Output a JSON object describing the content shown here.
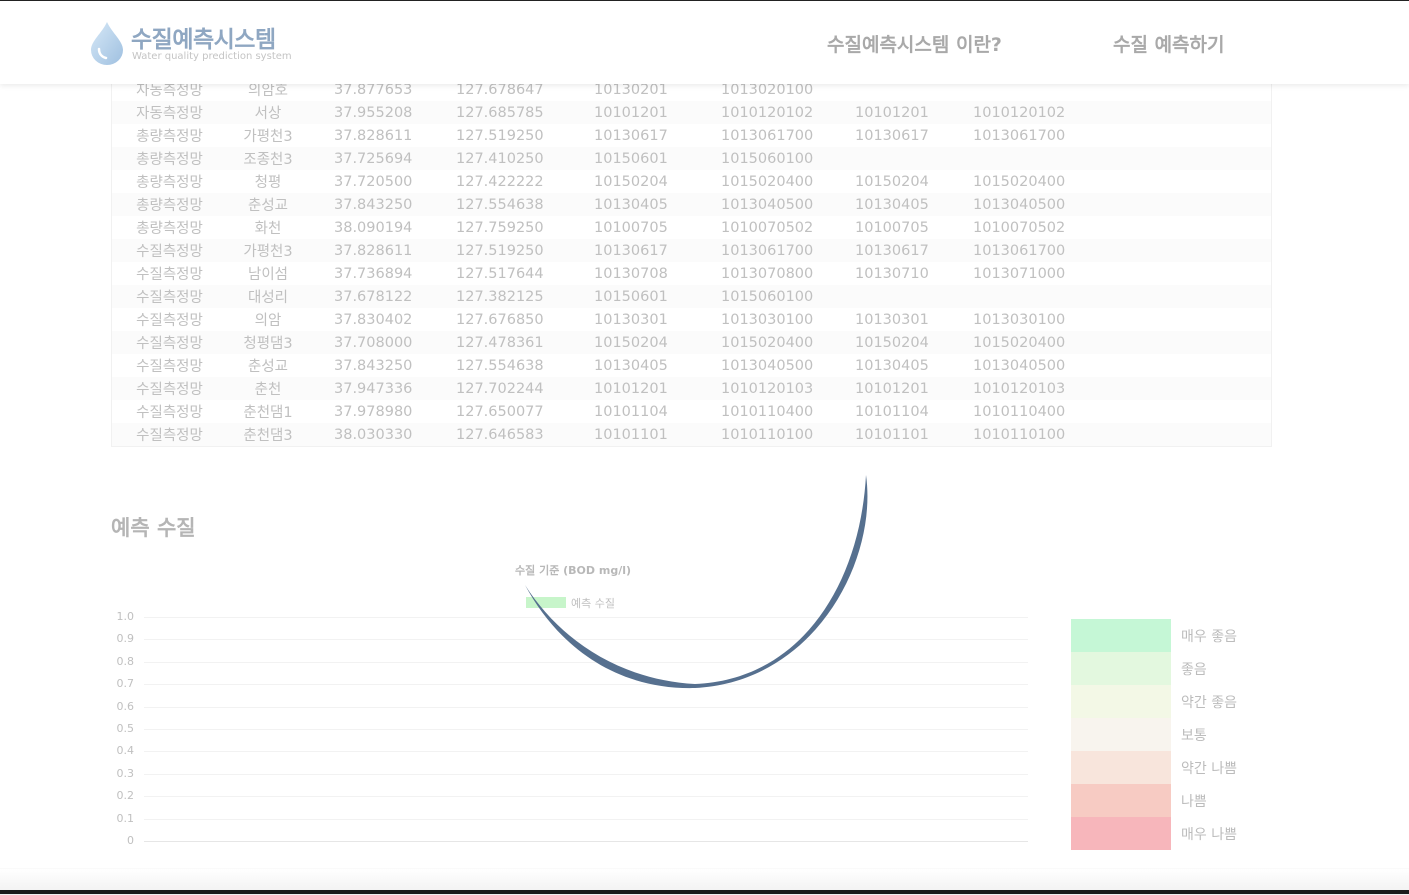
{
  "header": {
    "logo_title": "수질예측시스템",
    "logo_subtitle": "Water quality prediction system",
    "nav": [
      "수질예측시스템 이란?",
      "수질 예측하기"
    ]
  },
  "table": {
    "rows": [
      [
        "자동측정망",
        "의암호",
        "37.877653",
        "127.678647",
        "10130201",
        "1013020100",
        "",
        ""
      ],
      [
        "자동측정망",
        "서상",
        "37.955208",
        "127.685785",
        "10101201",
        "1010120102",
        "10101201",
        "1010120102"
      ],
      [
        "총량측정망",
        "가평천3",
        "37.828611",
        "127.519250",
        "10130617",
        "1013061700",
        "10130617",
        "1013061700"
      ],
      [
        "총량측정망",
        "조종천3",
        "37.725694",
        "127.410250",
        "10150601",
        "1015060100",
        "",
        ""
      ],
      [
        "총량측정망",
        "청평",
        "37.720500",
        "127.422222",
        "10150204",
        "1015020400",
        "10150204",
        "1015020400"
      ],
      [
        "총량측정망",
        "춘성교",
        "37.843250",
        "127.554638",
        "10130405",
        "1013040500",
        "10130405",
        "1013040500"
      ],
      [
        "총량측정망",
        "화천",
        "38.090194",
        "127.759250",
        "10100705",
        "1010070502",
        "10100705",
        "1010070502"
      ],
      [
        "수질측정망",
        "가평천3",
        "37.828611",
        "127.519250",
        "10130617",
        "1013061700",
        "10130617",
        "1013061700"
      ],
      [
        "수질측정망",
        "남이섬",
        "37.736894",
        "127.517644",
        "10130708",
        "1013070800",
        "10130710",
        "1013071000"
      ],
      [
        "수질측정망",
        "대성리",
        "37.678122",
        "127.382125",
        "10150601",
        "1015060100",
        "",
        ""
      ],
      [
        "수질측정망",
        "의암",
        "37.830402",
        "127.676850",
        "10130301",
        "1013030100",
        "10130301",
        "1013030100"
      ],
      [
        "수질측정망",
        "청평댐3",
        "37.708000",
        "127.478361",
        "10150204",
        "1015020400",
        "10150204",
        "1015020400"
      ],
      [
        "수질측정망",
        "춘성교",
        "37.843250",
        "127.554638",
        "10130405",
        "1013040500",
        "10130405",
        "1013040500"
      ],
      [
        "수질측정망",
        "춘천",
        "37.947336",
        "127.702244",
        "10101201",
        "1010120103",
        "10101201",
        "1010120103"
      ],
      [
        "수질측정망",
        "춘천댐1",
        "37.978980",
        "127.650077",
        "10101104",
        "1010110400",
        "10101104",
        "1010110400"
      ],
      [
        "수질측정망",
        "춘천댐3",
        "38.030330",
        "127.646583",
        "10101101",
        "1010110100",
        "10101101",
        "1010110100"
      ]
    ]
  },
  "prediction": {
    "section_title": "예측 수질"
  },
  "chart_data": {
    "type": "bar",
    "title": "수질 기준 (BOD mg/l)",
    "series": [
      {
        "name": "예측 수질",
        "values": [],
        "color": "#c7f5ca"
      }
    ],
    "categories": [],
    "ylim": [
      0,
      1
    ],
    "yticks": [
      "1.0",
      "0.9",
      "0.8",
      "0.7",
      "0.6",
      "0.5",
      "0.4",
      "0.3",
      "0.2",
      "0.1",
      "0"
    ],
    "grid": true,
    "legend": "top"
  },
  "quality_scale": [
    {
      "label": "매우 좋음",
      "color": "#c5f7d6"
    },
    {
      "label": "좋음",
      "color": "#e3f8df"
    },
    {
      "label": "약간 좋음",
      "color": "#f3f8e6"
    },
    {
      "label": "보통",
      "color": "#f8f4ee"
    },
    {
      "label": "약간 나쁨",
      "color": "#f8e5dc"
    },
    {
      "label": "나쁨",
      "color": "#f7cbc3"
    },
    {
      "label": "매우 나쁨",
      "color": "#f7b6bb"
    }
  ],
  "colors": {
    "logo": "#8fa7c2",
    "loading_arc": "#56708f"
  }
}
